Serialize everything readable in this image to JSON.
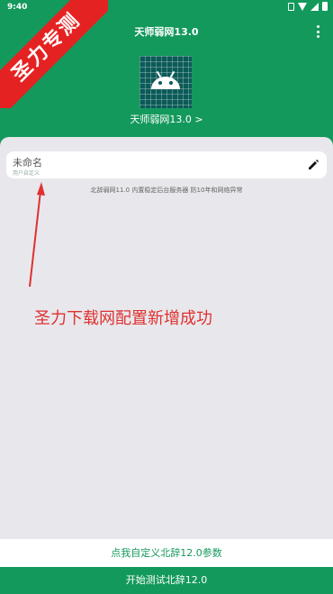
{
  "status_bar": {
    "time": "9:40"
  },
  "header": {
    "title": "天师弱网13.0",
    "version_link": "天师弱网13.0 >"
  },
  "profile": {
    "name": "未命名",
    "subtitle": "用户自定义"
  },
  "info_text": "北辞弱网11.0 内置稳定后台服务器 防10年和网络异常",
  "annotation": "圣力下载网配置新增成功",
  "buttons": {
    "custom": "点我自定义北辞12.0参数",
    "start": "开始测试北辞12.0"
  },
  "watermark": "圣力专测",
  "colors": {
    "brand_green": "#14995c",
    "annotation_red": "#e03030",
    "ribbon_red": "#e52222"
  }
}
